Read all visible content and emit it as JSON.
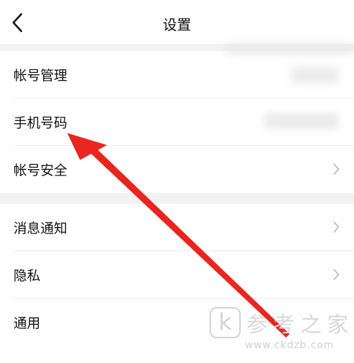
{
  "header": {
    "title": "设置",
    "back_icon": "chevron-left-icon"
  },
  "section_account": {
    "items": [
      {
        "label": "帐号管理",
        "has_chevron": false
      },
      {
        "label": "手机号码",
        "has_chevron": false
      },
      {
        "label": "帐号安全",
        "has_chevron": true
      }
    ]
  },
  "section_general": {
    "items": [
      {
        "label": "消息通知",
        "has_chevron": true
      },
      {
        "label": "隐私",
        "has_chevron": true
      },
      {
        "label": "通用",
        "has_chevron": false
      }
    ]
  },
  "annotation": {
    "arrow_color": "#e8251f"
  },
  "watermark": {
    "chinese": "参考之家",
    "url": "www.ckdzb.com",
    "logo_letter": "k"
  }
}
